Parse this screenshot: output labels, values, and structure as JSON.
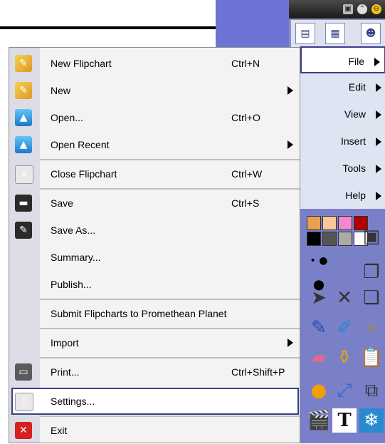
{
  "menu": {
    "items": [
      {
        "label": "New Flipchart",
        "shortcut": "Ctrl+N",
        "icon": "flipchart-icon"
      },
      {
        "label": "New",
        "shortcut": "",
        "icon": "new-flipchart-icon"
      },
      {
        "label": "Open...",
        "shortcut": "Ctrl+O",
        "icon": "open-folder-icon"
      },
      {
        "label": "Open Recent",
        "shortcut": "",
        "icon": "open-recent-folder-icon"
      },
      {
        "label": "Close Flipchart",
        "shortcut": "Ctrl+W",
        "icon": "close-flipchart-icon"
      },
      {
        "label": "Save",
        "shortcut": "Ctrl+S",
        "icon": "save-disk-icon"
      },
      {
        "label": "Save As...",
        "shortcut": "",
        "icon": "save-as-icon"
      },
      {
        "label": "Summary...",
        "shortcut": "",
        "icon": ""
      },
      {
        "label": "Publish...",
        "shortcut": "",
        "icon": ""
      },
      {
        "label": "Submit Flipcharts to Promethean Planet",
        "shortcut": "",
        "icon": ""
      },
      {
        "label": "Import",
        "shortcut": "",
        "icon": ""
      },
      {
        "label": "Print...",
        "shortcut": "Ctrl+Shift+P",
        "icon": "printer-icon"
      },
      {
        "label": "Settings...",
        "shortcut": "",
        "icon": "settings-icon"
      },
      {
        "label": "Exit",
        "shortcut": "",
        "icon": "exit-icon"
      }
    ]
  },
  "side_menu": {
    "items": [
      {
        "label": "File"
      },
      {
        "label": "Edit"
      },
      {
        "label": "View"
      },
      {
        "label": "Insert"
      },
      {
        "label": "Tools"
      },
      {
        "label": "Help"
      }
    ]
  },
  "colors": {
    "selection_border": "#3a3f8a",
    "toolbox_background": "#6d74d6",
    "menu_background": "#f3f3f3"
  }
}
